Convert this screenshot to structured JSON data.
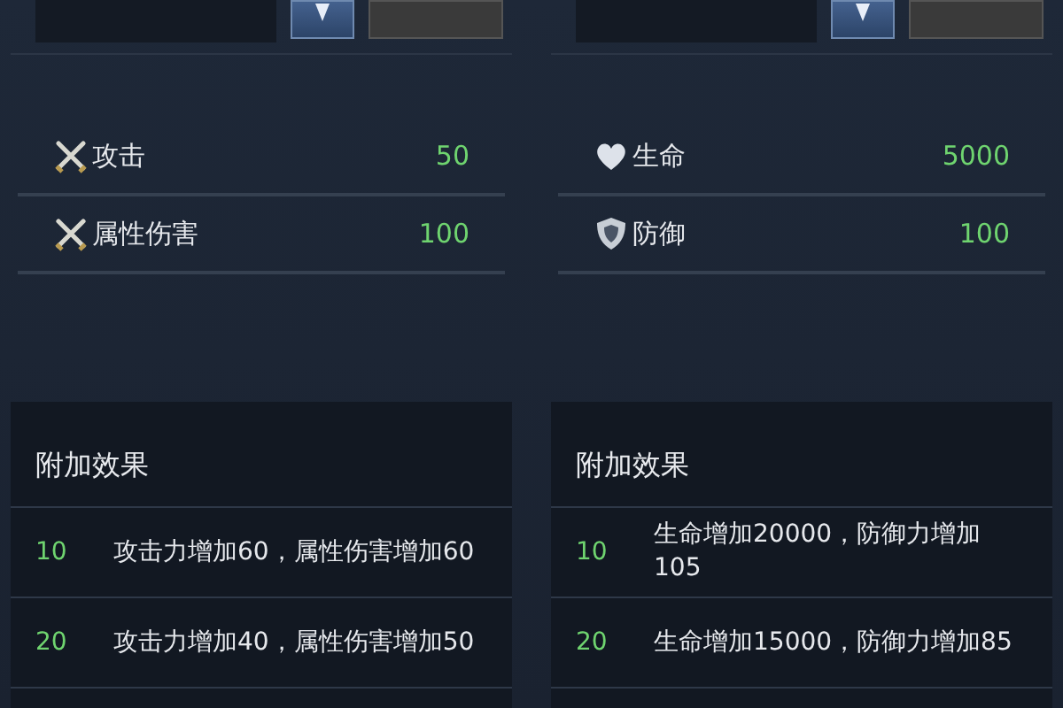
{
  "panels": [
    {
      "stats": [
        {
          "kind": "attack",
          "label": "攻击",
          "value": "50"
        },
        {
          "kind": "attack",
          "label": "属性伤害",
          "value": "100"
        }
      ],
      "effects": {
        "title": "附加效果",
        "rows": [
          {
            "level": "10",
            "text": "攻击力增加60，属性伤害增加60"
          },
          {
            "level": "20",
            "text": "攻击力增加40，属性伤害增加50"
          }
        ]
      }
    },
    {
      "stats": [
        {
          "kind": "health",
          "label": "生命",
          "value": "5000"
        },
        {
          "kind": "defense",
          "label": "防御",
          "value": "100"
        }
      ],
      "effects": {
        "title": "附加效果",
        "rows": [
          {
            "level": "10",
            "text": "生命增加20000，防御力增加105"
          },
          {
            "level": "20",
            "text": "生命增加15000，防御力增加85"
          }
        ]
      }
    }
  ]
}
